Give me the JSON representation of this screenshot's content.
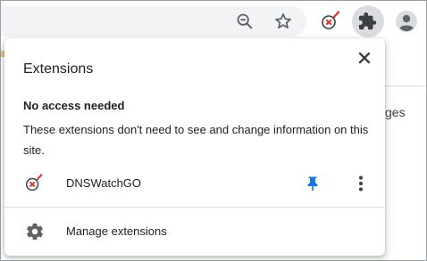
{
  "toolbar": {
    "zoom_icon": "zoom-out-icon",
    "bookmark_icon": "star-icon",
    "dns_ext_icon": "dnswatchgo-icon",
    "extensions_icon": "puzzle-icon",
    "profile_icon": "profile-avatar-icon"
  },
  "background_page": {
    "partial_text": "ges"
  },
  "popup": {
    "title": "Extensions",
    "close_icon": "close-icon",
    "section": {
      "heading": "No access needed",
      "description": "These extensions don't need to see and change information on this site."
    },
    "extensions": [
      {
        "name": "DNSWatchGO",
        "icon": "dnswatchgo-icon",
        "pinned": true,
        "pin_icon": "pin-icon",
        "menu_icon": "more-vert-icon"
      }
    ],
    "manage": {
      "label": "Manage extensions",
      "icon": "gear-icon"
    }
  },
  "colors": {
    "pin_blue": "#1a73e8",
    "icon_gray": "#5f6368",
    "dns_red": "#d93025"
  }
}
